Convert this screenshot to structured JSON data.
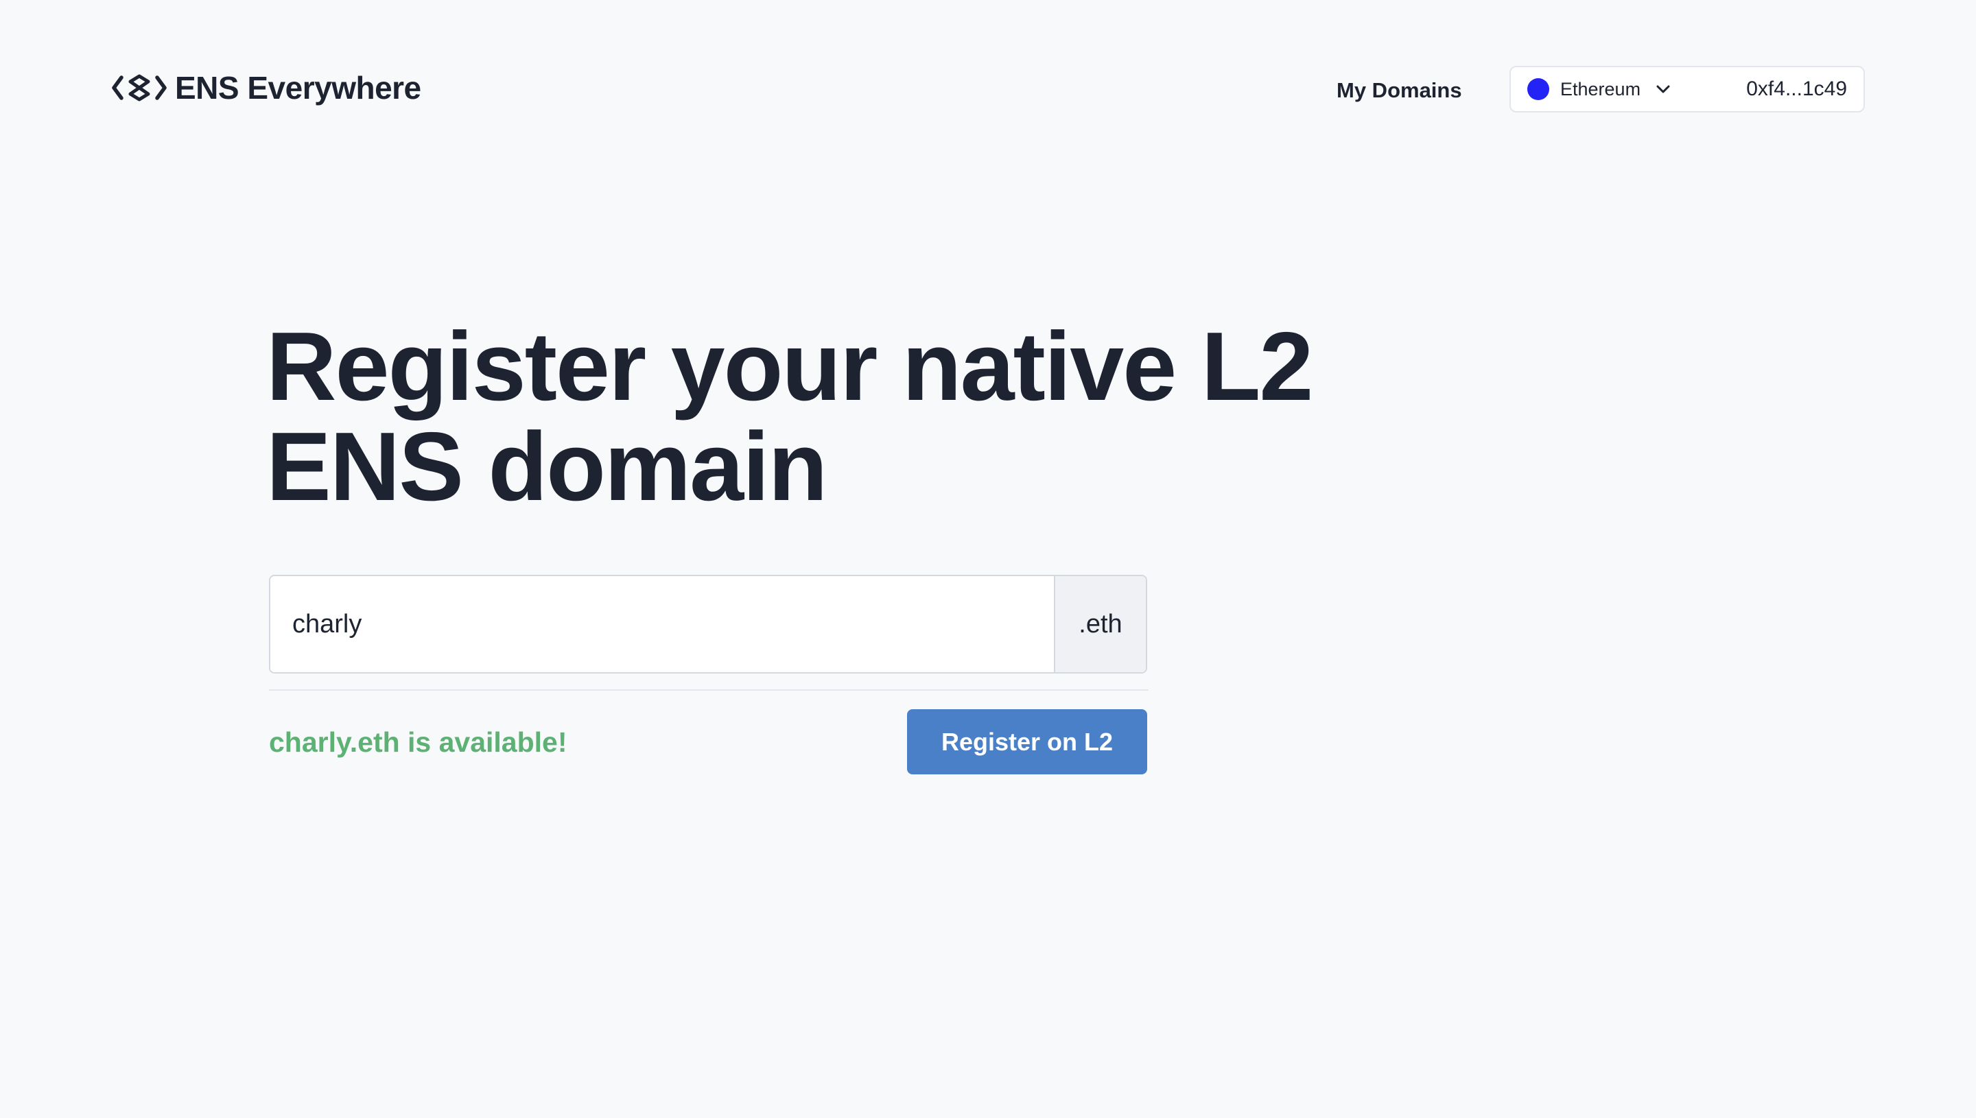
{
  "header": {
    "brand_name": "ENS Everywhere",
    "brand_icon": "ens-logo-icon",
    "nav_my_domains": "My Domains",
    "network": {
      "label": "Ethereum",
      "color": "#2323F5",
      "icon": "chevron-down-icon"
    },
    "address": "0xf4...1c49"
  },
  "hero": {
    "title_line1": "Register your native L2",
    "title_line2": "ENS domain"
  },
  "search": {
    "value": "charly",
    "suffix": ".eth"
  },
  "status": {
    "availability_text": "charly.eth is available!",
    "color": "#5EB174"
  },
  "actions": {
    "register_label": "Register on L2",
    "color": "#4A80C8"
  }
}
